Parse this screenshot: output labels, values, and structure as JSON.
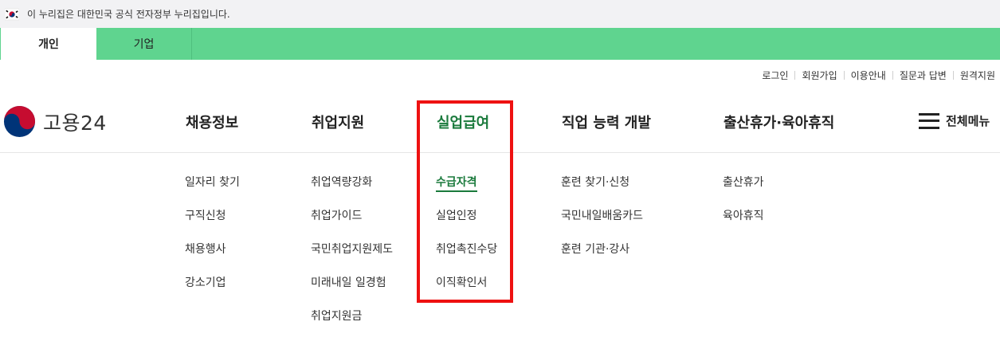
{
  "gov_banner": {
    "text": "이 누리집은 대한민국 공식 전자정부 누리집입니다."
  },
  "tabs": [
    {
      "label": "개인",
      "active": true
    },
    {
      "label": "기업",
      "active": false
    }
  ],
  "util_links": [
    "로그인",
    "회원가입",
    "이용안내",
    "질문과 답변",
    "원격지원"
  ],
  "logo": {
    "text": "고용24"
  },
  "gnb": [
    {
      "label": "채용정보",
      "items": [
        "일자리 찾기",
        "구직신청",
        "채용행사",
        "강소기업"
      ]
    },
    {
      "label": "취업지원",
      "items": [
        "취업역량강화",
        "취업가이드",
        "국민취업지원제도",
        "미래내일 일경험",
        "취업지원금"
      ]
    },
    {
      "label": "실업급여",
      "items": [
        "수급자격",
        "실업인정",
        "취업촉진수당",
        "이직확인서"
      ]
    },
    {
      "label": "직업 능력 개발",
      "items": [
        "훈련 찾기·신청",
        "국민내일배움카드",
        "훈련 기관·강사"
      ]
    },
    {
      "label": "출산휴가·육아휴직",
      "items": [
        "출산휴가",
        "육아휴직"
      ]
    }
  ],
  "allmenu": {
    "label": "전체메뉴"
  },
  "colors": {
    "tab_bar": "#5fd48f",
    "active_text": "#1a7a3c",
    "highlight_box": "#ee1111"
  }
}
